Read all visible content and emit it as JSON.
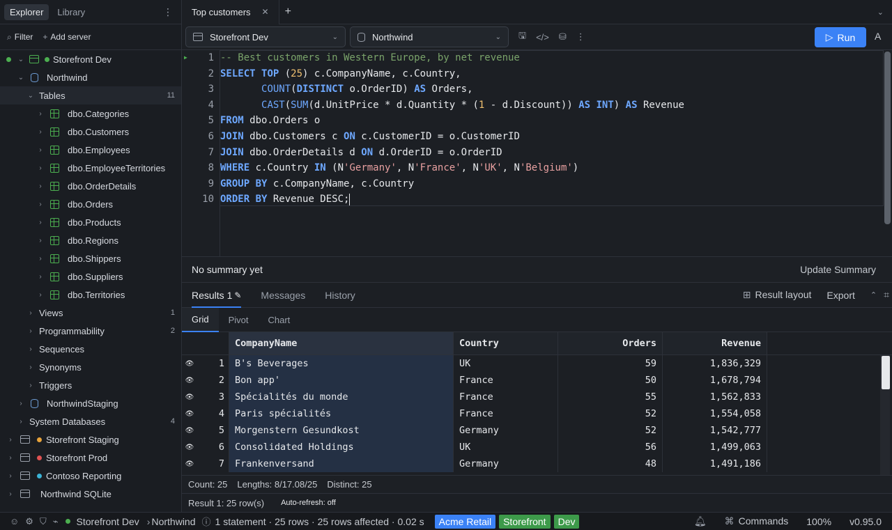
{
  "sidebar": {
    "tabs": [
      "Explorer",
      "Library"
    ],
    "filter_label": "Filter",
    "add_server_label": "Add server",
    "tree": {
      "server_active": "Storefront Dev",
      "database": "Northwind",
      "tables_label": "Tables",
      "tables_count": "11",
      "tables": [
        "dbo.Categories",
        "dbo.Customers",
        "dbo.Employees",
        "dbo.EmployeeTerritories",
        "dbo.OrderDetails",
        "dbo.Orders",
        "dbo.Products",
        "dbo.Regions",
        "dbo.Shippers",
        "dbo.Suppliers",
        "dbo.Territories"
      ],
      "views_label": "Views",
      "views_count": "1",
      "programmability_label": "Programmability",
      "programmability_count": "2",
      "sequences_label": "Sequences",
      "synonyms_label": "Synonyms",
      "triggers_label": "Triggers",
      "staging_db": "NorthwindStaging",
      "system_db_label": "System Databases",
      "system_db_count": "4",
      "other_servers": [
        {
          "name": "Storefront Staging",
          "dot": "#e8a33a"
        },
        {
          "name": "Storefront Prod",
          "dot": "#e05252"
        },
        {
          "name": "Contoso Reporting",
          "dot": "#3bb3d6"
        },
        {
          "name": "Northwind SQLite",
          "dot": ""
        }
      ]
    }
  },
  "tabs": {
    "query_tab": "Top customers"
  },
  "toolbar": {
    "server": "Storefront Dev",
    "database": "Northwind",
    "run_label": "Run",
    "a_label": "A"
  },
  "editor": {
    "line_numbers": [
      "1",
      "2",
      "3",
      "4",
      "5",
      "6",
      "7",
      "8",
      "9",
      "10"
    ]
  },
  "summary": {
    "text": "No summary yet",
    "update_label": "Update Summary"
  },
  "results": {
    "tabs": [
      "Results 1",
      "Messages",
      "History"
    ],
    "result_layout_label": "Result layout",
    "export_label": "Export",
    "subtabs": [
      "Grid",
      "Pivot",
      "Chart"
    ],
    "columns": [
      "CompanyName",
      "Country",
      "Orders",
      "Revenue"
    ],
    "rows": [
      {
        "idx": "1",
        "name": "B's Beverages",
        "country": "UK",
        "orders": "59",
        "revenue": "1,836,329"
      },
      {
        "idx": "2",
        "name": "Bon app'",
        "country": "France",
        "orders": "50",
        "revenue": "1,678,794"
      },
      {
        "idx": "3",
        "name": "Spécialités du monde",
        "country": "France",
        "orders": "55",
        "revenue": "1,562,833"
      },
      {
        "idx": "4",
        "name": "Paris spécialités",
        "country": "France",
        "orders": "52",
        "revenue": "1,554,058"
      },
      {
        "idx": "5",
        "name": "Morgenstern Gesundkost",
        "country": "Germany",
        "orders": "52",
        "revenue": "1,542,777"
      },
      {
        "idx": "6",
        "name": "Consolidated Holdings",
        "country": "UK",
        "orders": "56",
        "revenue": "1,499,063"
      },
      {
        "idx": "7",
        "name": "Frankenversand",
        "country": "Germany",
        "orders": "48",
        "revenue": "1,491,186"
      }
    ],
    "stats": {
      "count": "Count: 25",
      "lengths": "Lengths: 8/17.08/25",
      "distinct": "Distinct: 25"
    },
    "status": "Result 1: 25 row(s)",
    "auto_refresh": "Auto-refresh: off"
  },
  "statusbar": {
    "server": "Storefront Dev",
    "database": "Northwind",
    "info": "1 statement · 25 rows · 25 rows affected · 0.02 s",
    "badges": [
      {
        "label": "Acme Retail",
        "color": "#3b82f6"
      },
      {
        "label": "Storefront",
        "color": "#3d9a4a"
      },
      {
        "label": "Dev",
        "color": "#3d9a4a"
      }
    ],
    "commands_label": "Commands",
    "zoom": "100%",
    "version": "v0.95.0"
  }
}
